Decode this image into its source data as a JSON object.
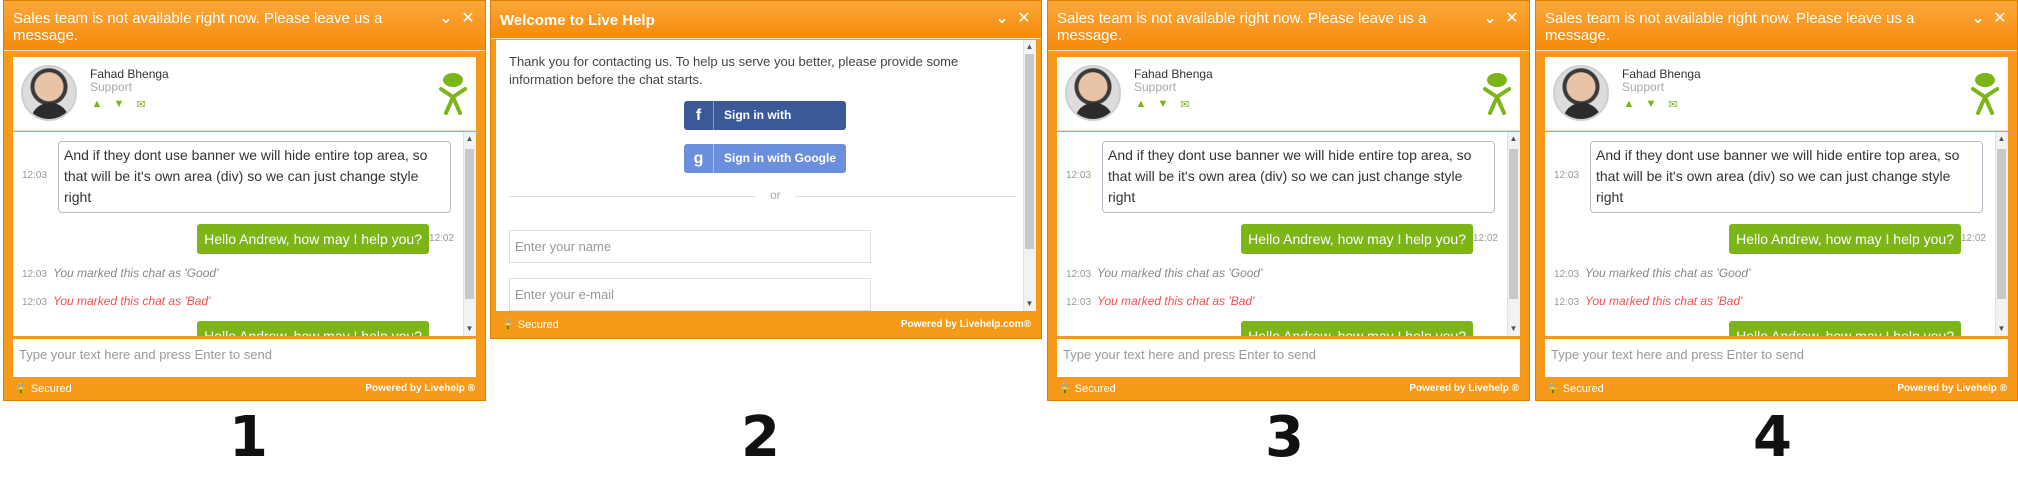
{
  "chat": {
    "header": "Sales team is not available right now. Please leave us a message.",
    "agent_name": "Fahad Bhenga",
    "agent_role": "Support",
    "incoming_message": "And if they dont use banner we will hide entire top area, so that will be it's own area (div) so we can just change style right",
    "incoming_time": "12:03",
    "outgoing_message": "Hello Andrew, how may I help you?",
    "outgoing_time": "12:02",
    "sys_good_time": "12:03",
    "sys_good": "You marked this chat as 'Good'",
    "sys_bad_time": "12:03",
    "sys_bad": "You marked this chat as 'Bad'",
    "partial_message": "Hello Andrew, how may I help you?",
    "input_placeholder": "Type your text here and press Enter to send",
    "secured": "Secured",
    "powered": "Powered by Livehelp ®"
  },
  "welcome": {
    "header": "Welcome to Live Help",
    "intro": "Thank you for contacting us. To help us serve you better, please provide some information before the chat starts.",
    "facebook_btn": "Sign in with Facebook",
    "google_btn": "Sign in with Google",
    "or_text": "or",
    "name_placeholder": "Enter your name",
    "email_placeholder": "Enter your e-mail",
    "secured": "Secured",
    "powered": "Powered by Livehelp.com®"
  },
  "labels": [
    "1",
    "2",
    "3",
    "4"
  ],
  "colors": {
    "orange": "#f79a1a",
    "green": "#7cb518",
    "facebook": "#3b5998",
    "google": "#6b8fdc"
  },
  "icons": [
    "minimize-icon",
    "close-icon",
    "thumbs-up-icon",
    "thumbs-down-icon",
    "email-icon",
    "lock-icon",
    "livehelp-logo-icon",
    "facebook-icon",
    "google-icon"
  ]
}
